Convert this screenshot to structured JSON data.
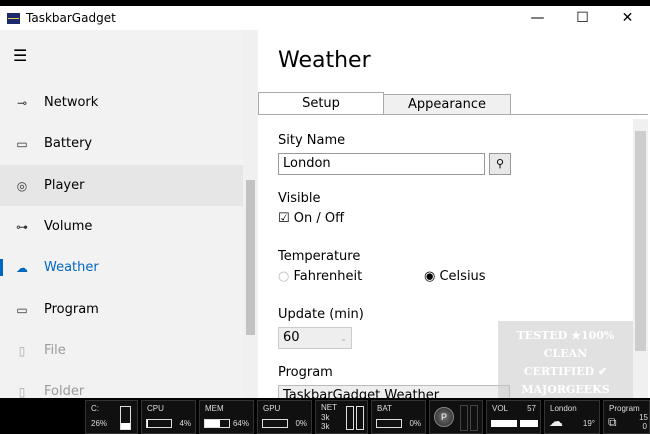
{
  "window": {
    "title": "TaskbarGadget",
    "minimize": "—",
    "maximize": "☐",
    "close": "✕"
  },
  "sidebar": {
    "menu_icon": "☰",
    "items": [
      {
        "label": "Network",
        "icon": "⊸"
      },
      {
        "label": "Battery",
        "icon": "▭"
      },
      {
        "label": "Player",
        "icon": "◎"
      },
      {
        "label": "Volume",
        "icon": "⊶"
      },
      {
        "label": "Weather",
        "icon": "☁"
      },
      {
        "label": "Program",
        "icon": "▭"
      },
      {
        "label": "File",
        "icon": "▯"
      },
      {
        "label": "Folder",
        "icon": "▯"
      }
    ]
  },
  "main": {
    "title": "Weather",
    "tabs": [
      "Setup",
      "Appearance"
    ],
    "city_label": "Sity Name",
    "city_value": "London",
    "visible_label": "Visible",
    "visible_check": "On / Off",
    "temp_label": "Temperature",
    "fahrenheit": "Fahrenheit",
    "celsius": "Celsius",
    "update_label": "Update (min)",
    "update_value": "60",
    "program_label": "Program",
    "program_value": "TaskbarGadget Weather"
  },
  "watermark": "TESTED ★100% CLEAN CERTIFIED MAJORGEEKS .COM",
  "taskbar": {
    "disk": {
      "label": "C:",
      "value": "26%",
      "fill": 0.26
    },
    "cpu": {
      "label": "CPU",
      "value": "4%",
      "fill": 0.04
    },
    "mem": {
      "label": "MEM",
      "value": "64%",
      "fill": 0.64
    },
    "gpu": {
      "label": "GPU",
      "value": "0%",
      "fill": 0
    },
    "net": {
      "label": "NET",
      "up": "3k",
      "down": "3k"
    },
    "bat": {
      "label": "BAT",
      "value": "0%",
      "fill": 0
    },
    "player": {
      "label": "P"
    },
    "vol": {
      "label": "VOL",
      "value": "57"
    },
    "weather": {
      "city": "London",
      "temp": "19°"
    },
    "program": {
      "label": "Program",
      "v1": "15",
      "v2": "0"
    }
  }
}
